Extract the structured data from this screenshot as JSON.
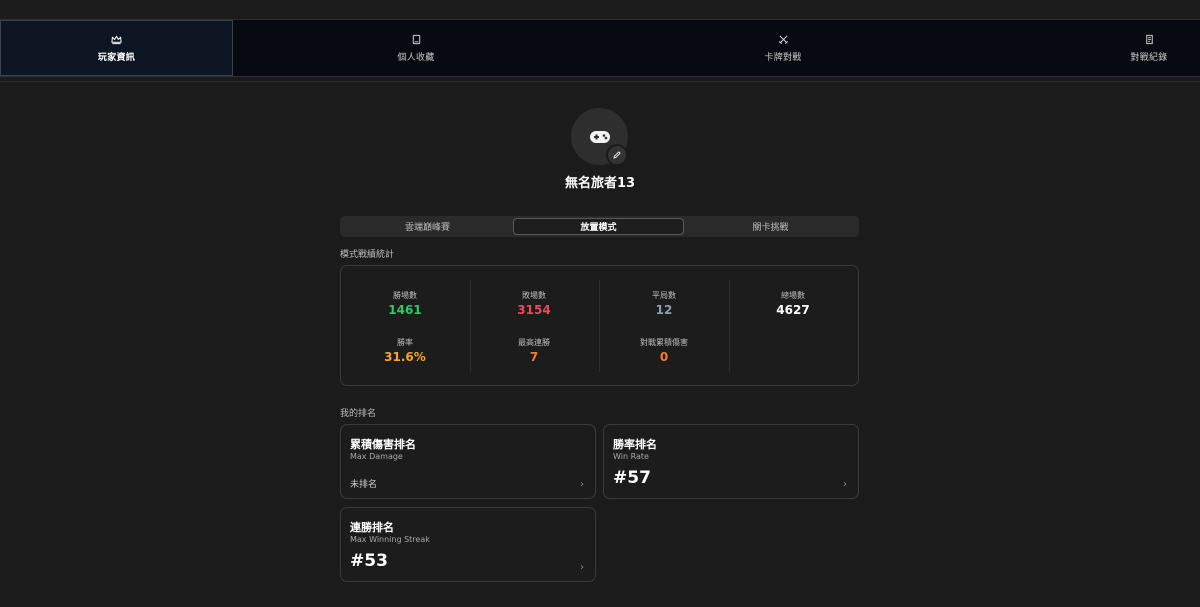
{
  "nav": {
    "tabs": [
      {
        "label": "玩家資訊",
        "icon": "crown-icon",
        "active": true
      },
      {
        "label": "個人收藏",
        "icon": "card-icon",
        "active": false
      },
      {
        "label": "卡牌對戰",
        "icon": "crossed-swords-icon",
        "active": false
      },
      {
        "label": "對戰紀錄",
        "icon": "scroll-icon",
        "active": false
      }
    ]
  },
  "profile": {
    "avatar_icon": "gamepad-icon",
    "edit_icon": "pencil-icon",
    "username": "無名旅者13"
  },
  "mode_tabs": [
    {
      "label": "雲端巔峰賽",
      "active": false
    },
    {
      "label": "放置模式",
      "active": true
    },
    {
      "label": "關卡挑戰",
      "active": false
    }
  ],
  "stats_section": {
    "title": "模式戰績統計",
    "items": [
      {
        "label": "勝場數",
        "value": "1461",
        "color": "#2ec866"
      },
      {
        "label": "敗場數",
        "value": "3154",
        "color": "#f0475e"
      },
      {
        "label": "平局數",
        "value": "12",
        "color": "#8f9db3"
      },
      {
        "label": "總場數",
        "value": "4627",
        "color": "#ffffff"
      },
      {
        "label": "勝率",
        "value": "31.6%",
        "color": "#f5a623"
      },
      {
        "label": "最高連勝",
        "value": "7",
        "color": "#f57c2f"
      },
      {
        "label": "對戰累積傷害",
        "value": "0",
        "color": "#f57c2f"
      }
    ]
  },
  "ranking_section": {
    "title": "我的排名",
    "cards": [
      {
        "title": "累積傷害排名",
        "subtitle": "Max Damage",
        "value": "未排名",
        "ranked": false
      },
      {
        "title": "勝率排名",
        "subtitle": "Win Rate",
        "value": "#57",
        "ranked": true
      },
      {
        "title": "連勝排名",
        "subtitle": "Max Winning Streak",
        "value": "#53",
        "ranked": true
      }
    ],
    "chevron": "›"
  }
}
